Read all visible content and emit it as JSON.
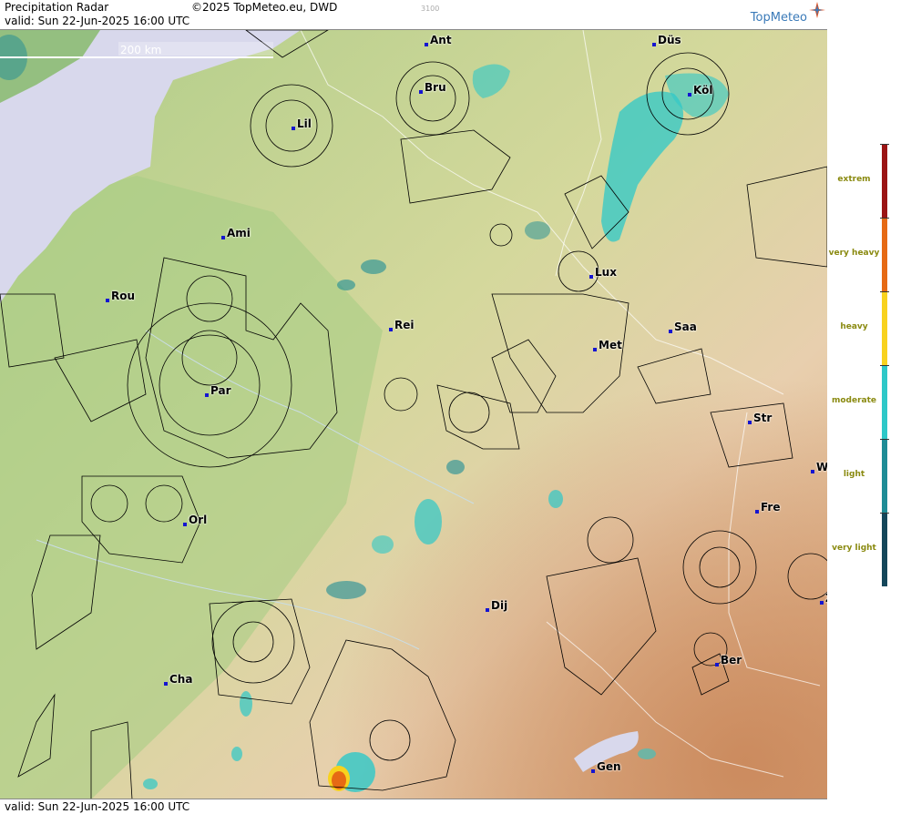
{
  "header": {
    "title": "Precipitation Radar",
    "valid": "valid:  Sun  22-Jun-2025 16:00 UTC",
    "copyright": "©2025 TopMeteo.eu, DWD",
    "code": "3100",
    "logo": "TopMeteo"
  },
  "footer": {
    "valid": "valid:  Sun  22-Jun-2025 16:00 UTC"
  },
  "scale_bar": {
    "label": "200 km"
  },
  "legend": {
    "levels": [
      {
        "label": "extrem",
        "color": "#9b1414"
      },
      {
        "label": "very heavy",
        "color": "#e66a14"
      },
      {
        "label": "heavy",
        "color": "#f8d21e"
      },
      {
        "label": "moderate",
        "color": "#2ec8c8"
      },
      {
        "label": "light",
        "color": "#1e8c96"
      },
      {
        "label": "very light",
        "color": "#14465a"
      }
    ]
  },
  "cities": [
    {
      "name": "Ant"
    },
    {
      "name": "Düs"
    },
    {
      "name": "Bru"
    },
    {
      "name": "Köl"
    },
    {
      "name": "Lil"
    },
    {
      "name": "Ami"
    },
    {
      "name": "Lux"
    },
    {
      "name": "Rou"
    },
    {
      "name": "Rei"
    },
    {
      "name": "Saa"
    },
    {
      "name": "Met"
    },
    {
      "name": "Par"
    },
    {
      "name": "Str"
    },
    {
      "name": "W"
    },
    {
      "name": "Fre"
    },
    {
      "name": "Orl"
    },
    {
      "name": "Dij"
    },
    {
      "name": "Ber"
    },
    {
      "name": "Z"
    },
    {
      "name": "Cha"
    },
    {
      "name": "Gen"
    }
  ],
  "colors": {
    "sea": "#d8d8ec",
    "lowland": "#b8d494",
    "upland": "#e6c8a6",
    "mountain": "#d89c6c"
  }
}
